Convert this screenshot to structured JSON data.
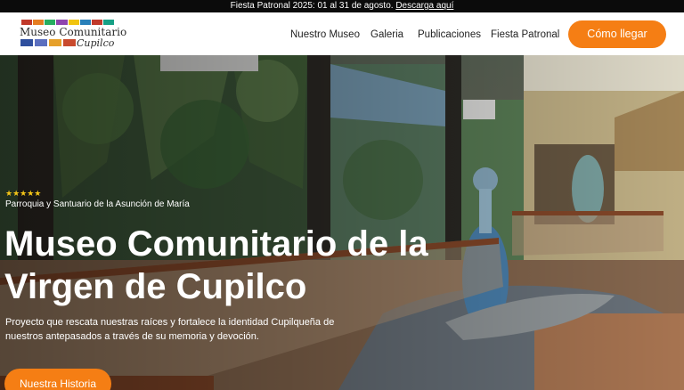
{
  "topbar": {
    "text": "Fiesta Patronal 2025: 01 al 31 de agosto.",
    "link": "Descarga aquí"
  },
  "logo": {
    "line1": "Museo Comunitario",
    "line2": "Cupilco",
    "pattern_colors": [
      "#c0392b",
      "#e67e22",
      "#27ae60",
      "#8e44ad",
      "#f1c40f",
      "#2980b9",
      "#c0392b",
      "#16a085"
    ],
    "square_colors": [
      "#2f4f9e",
      "#5b6fbf",
      "#e6a02a",
      "#c94a2d"
    ]
  },
  "nav": {
    "items": [
      "Nuestro Museo",
      "Galeria",
      "Publicaciones",
      "Fiesta Patronal"
    ],
    "cta": "Cómo llegar"
  },
  "hero": {
    "rating": "★★★★★",
    "kicker": "Parroquia y Santuario de la Asunción de María",
    "title": "Museo Comunitario de la Virgen de Cupilco",
    "subtitle": "Proyecto que rescata nuestras raíces y fortalece la identidad Cupilqueña de nuestros antepasados a través de su memoria y devoción.",
    "cta": "Nuestra Historia"
  },
  "colors": {
    "accent": "#f57e14",
    "topbar_bg": "#0b0b0b",
    "star": "#f5c518"
  }
}
